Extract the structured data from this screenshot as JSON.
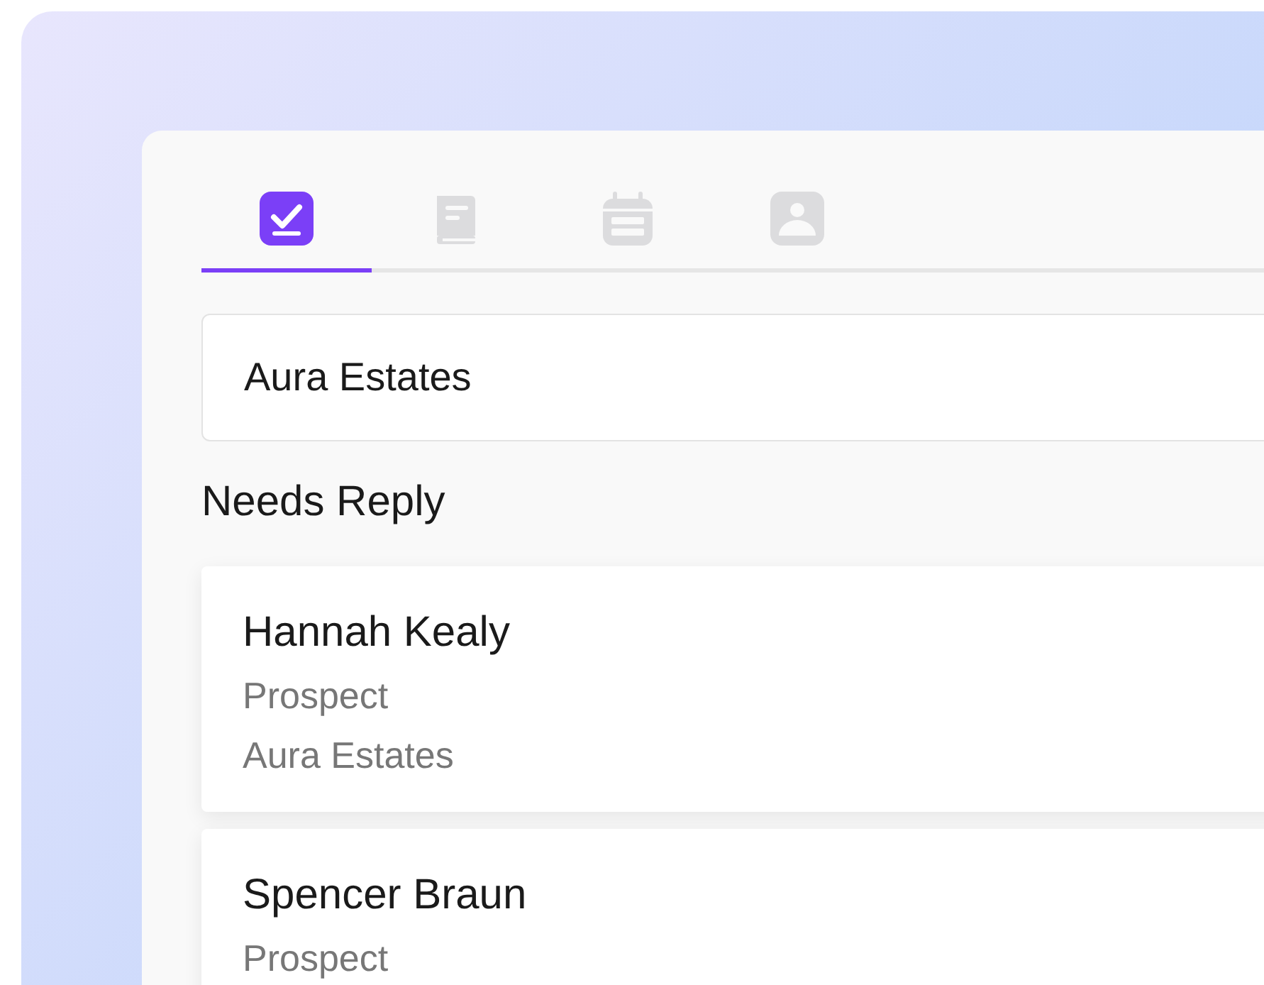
{
  "tabs": [
    {
      "kind": "tasks",
      "selected": true
    },
    {
      "kind": "book",
      "selected": false
    },
    {
      "kind": "calendar",
      "selected": false
    },
    {
      "kind": "contact",
      "selected": false
    }
  ],
  "search": {
    "value": "Aura Estates"
  },
  "section_title": "Needs Reply",
  "contacts": [
    {
      "name": "Hannah Kealy",
      "role": "Prospect",
      "company": "Aura Estates"
    },
    {
      "name": "Spencer Braun",
      "role": "Prospect"
    }
  ]
}
